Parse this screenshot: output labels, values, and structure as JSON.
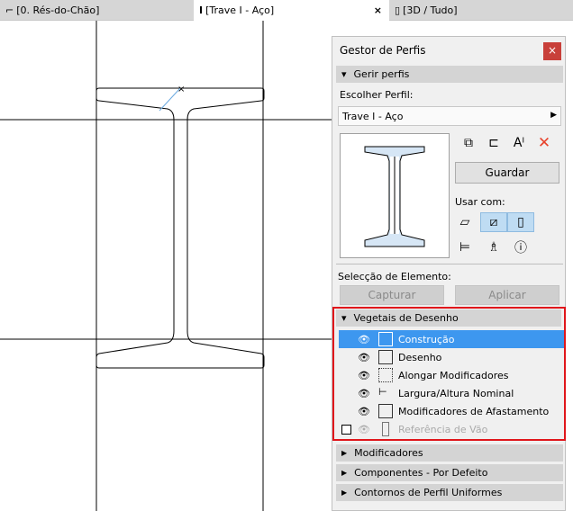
{
  "tabs": [
    {
      "label": "[0. Rés-do-Chão]",
      "icon": "floor-plan-icon"
    },
    {
      "label": "[Trave I - Aço]",
      "icon": "ibeam-icon",
      "close": "×"
    },
    {
      "label": "[3D / Tudo]",
      "icon": "3d-box-icon"
    }
  ],
  "panel": {
    "title": "Gestor de Perfis",
    "close": "×",
    "manage_section": "Gerir perfis",
    "choose_label": "Escolher Perfil:",
    "profile_value": "Trave I - Aço",
    "save_button": "Guardar",
    "use_with_label": "Usar com:",
    "selection_label": "Selecção de Elemento:",
    "capture_button": "Capturar",
    "apply_button": "Aplicar",
    "drawing_section": "Vegetais de Desenho",
    "drawing_items": [
      {
        "label": "Construção",
        "selected": true,
        "visible": true
      },
      {
        "label": "Desenho",
        "visible": true
      },
      {
        "label": "Alongar Modificadores",
        "visible": true
      },
      {
        "label": "Largura/Altura Nominal",
        "visible": true
      },
      {
        "label": "Modificadores de Afastamento",
        "visible": true
      },
      {
        "label": "Referência de Vão",
        "visible": false,
        "disabled": true
      }
    ],
    "collapsed_sections": [
      "Modificadores",
      "Componentes - Por Defeito",
      "Contornos de Perfil Uniformes"
    ]
  },
  "colors": {
    "accent": "#3d97ef",
    "close": "#c8403a",
    "highlight": "#e0161b"
  }
}
